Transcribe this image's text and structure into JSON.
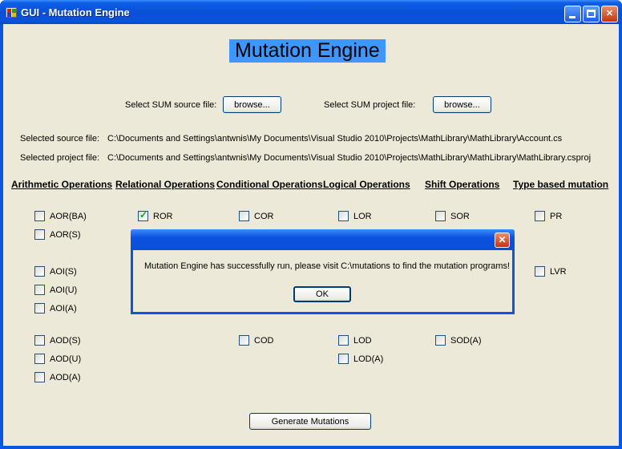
{
  "window": {
    "title": "GUI - Mutation Engine"
  },
  "heading": "Mutation Engine",
  "file_selection": {
    "source_label": "Select SUM source file:",
    "project_label": "Select SUM project file:",
    "browse_label": "browse...",
    "selected_source_label": "Selected source file:",
    "selected_source_value": "C:\\Documents and Settings\\antwnis\\My Documents\\Visual Studio 2010\\Projects\\MathLibrary\\MathLibrary\\Account.cs",
    "selected_project_label": "Selected project file:",
    "selected_project_value": "C:\\Documents and Settings\\antwnis\\My Documents\\Visual Studio 2010\\Projects\\MathLibrary\\MathLibrary\\MathLibrary.csproj"
  },
  "categories": {
    "arithmetic": "Arithmetic Operations",
    "relational": "Relational Operations",
    "conditional": "Conditional Operations",
    "logical": "Logical Operations",
    "shift": "Shift Operations",
    "type": "Type based mutation"
  },
  "operators": {
    "aorba": {
      "label": "AOR(BA)",
      "checked": false
    },
    "aors": {
      "label": "AOR(S)",
      "checked": false
    },
    "aois": {
      "label": "AOI(S)",
      "checked": false
    },
    "aoiu": {
      "label": "AOI(U)",
      "checked": false
    },
    "aoia": {
      "label": "AOI(A)",
      "checked": false
    },
    "aods": {
      "label": "AOD(S)",
      "checked": false
    },
    "aodu": {
      "label": "AOD(U)",
      "checked": false
    },
    "aoda": {
      "label": "AOD(A)",
      "checked": false
    },
    "ror": {
      "label": "ROR",
      "checked": true
    },
    "cor": {
      "label": "COR",
      "checked": false
    },
    "cod": {
      "label": "COD",
      "checked": false
    },
    "lor": {
      "label": "LOR",
      "checked": false
    },
    "lod": {
      "label": "LOD",
      "checked": false
    },
    "loda": {
      "label": "LOD(A)",
      "checked": false
    },
    "sor": {
      "label": "SOR",
      "checked": false
    },
    "soda": {
      "label": "SOD(A)",
      "checked": false
    },
    "pr": {
      "label": "PR",
      "checked": false
    },
    "lvr": {
      "label": "LVR",
      "checked": false
    }
  },
  "check_glyph": "✓",
  "generate_label": "Generate Mutations",
  "dialog": {
    "message": "Mutation Engine has successfully run, please visit C:\\mutations to find the mutation programs!",
    "ok_label": "OK"
  },
  "colors": {
    "accent": "#3d97ff",
    "titlebar": "#0a55e3",
    "client": "#ece9d8",
    "check": "#21a121"
  }
}
